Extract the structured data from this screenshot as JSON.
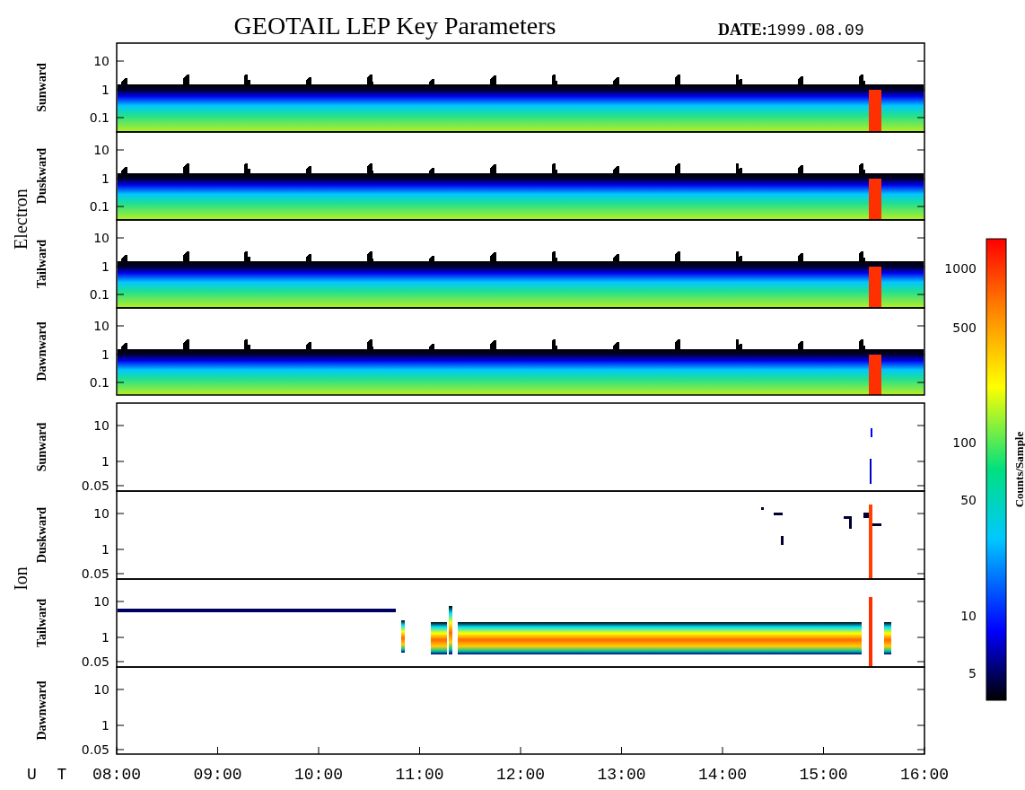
{
  "title": "GEOTAIL LEP Key Parameters",
  "date": {
    "label": "DATE:",
    "value": "1999.08.09"
  },
  "groups": [
    {
      "name": "Electron",
      "panels": [
        {
          "label": "Sunward",
          "kind": "full",
          "y_ticks": [
            "10",
            "1",
            "0.1"
          ]
        },
        {
          "label": "Duskward",
          "kind": "full",
          "y_ticks": [
            "10",
            "1",
            "0.1"
          ]
        },
        {
          "label": "Tailward",
          "kind": "full",
          "y_ticks": [
            "10",
            "1",
            "0.1"
          ]
        },
        {
          "label": "Dawnward",
          "kind": "full",
          "y_ticks": [
            "10",
            "1",
            "0.1"
          ]
        }
      ]
    },
    {
      "name": "Ion",
      "panels": [
        {
          "label": "Sunward",
          "kind": "spike",
          "y_ticks": [
            "10",
            "1",
            "0.05"
          ]
        },
        {
          "label": "Duskward",
          "kind": "sparse",
          "y_ticks": [
            "10",
            "1",
            "0.05"
          ]
        },
        {
          "label": "Tailward",
          "kind": "band",
          "y_ticks": [
            "10",
            "1",
            "0.05"
          ]
        },
        {
          "label": "Dawnward",
          "kind": "empty",
          "y_ticks": [
            "10",
            "1",
            "0.05"
          ]
        }
      ]
    }
  ],
  "colorbar": {
    "label": "Counts/Sample",
    "ticks": [
      "1000",
      "500",
      "100",
      "50",
      "10",
      "5"
    ]
  },
  "x_axis": {
    "label": "U T",
    "ticks": [
      "08:00",
      "09:00",
      "10:00",
      "11:00",
      "12:00",
      "13:00",
      "14:00",
      "15:00",
      "16:00"
    ]
  }
}
